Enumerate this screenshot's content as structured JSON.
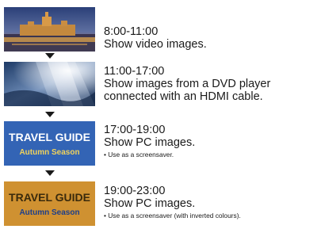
{
  "schedule": [
    {
      "time": "8:00-11:00",
      "lines": [
        "Show video images."
      ],
      "note": "",
      "thumbnail": "city-night-photo"
    },
    {
      "time": "11:00-17:00",
      "lines": [
        "Show images from a DVD player",
        "connected with an HDMI cable."
      ],
      "note": "",
      "thumbnail": "ocean-light-photo"
    },
    {
      "time": "17:00-19:00",
      "lines": [
        "Show PC images."
      ],
      "note": "• Use as a screensaver.",
      "thumbnail": "travel-guide-blue",
      "thumb_text": {
        "title": "TRAVEL GUIDE",
        "subtitle": "Autumn Season"
      },
      "colors": {
        "background": "#2f5fae",
        "title": "#ffffff",
        "subtitle": "#f2d35a"
      }
    },
    {
      "time": "19:00-23:00",
      "lines": [
        "Show PC images."
      ],
      "note": "• Use as a screensaver (with inverted colours).",
      "thumbnail": "travel-guide-inverted",
      "thumb_text": {
        "title": "TRAVEL GUIDE",
        "subtitle": "Autumn Season"
      },
      "colors": {
        "background": "#c98a2c",
        "title": "#3a2a0c",
        "subtitle": "#1c3f8c"
      }
    }
  ],
  "arrow_icon": "down-arrow-icon"
}
